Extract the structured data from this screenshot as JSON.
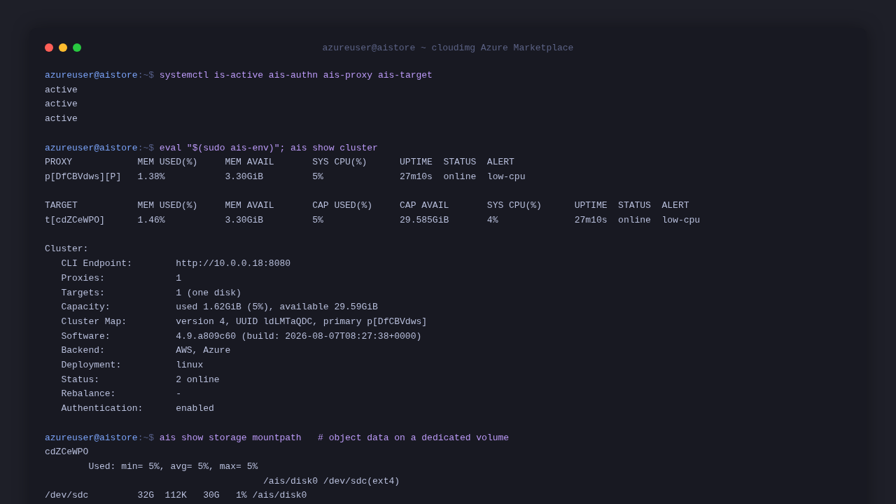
{
  "window": {
    "title": "azureuser@aistore ~ cloudimg Azure Marketplace",
    "buttons": [
      {
        "kind": "close"
      },
      {
        "kind": "minimize"
      },
      {
        "kind": "zoom"
      }
    ]
  },
  "blocks": [
    {
      "kind": "session",
      "prompt": {
        "user": "azureuser@aistore",
        "path": ":~$"
      },
      "command": "systemctl is-active ais-authn ais-proxy ais-target",
      "lines": [
        "active",
        "active",
        "active"
      ]
    },
    {
      "kind": "cluster",
      "prompt": {
        "user": "azureuser@aistore",
        "path": ":~$"
      },
      "command": "eval \"$(sudo ais-env)\"; ais show cluster",
      "tables": [
        {
          "columns": [
            "PROXY",
            "MEM USED(%)",
            "MEM AVAIL",
            "SYS CPU(%)",
            "UPTIME",
            "STATUS",
            "ALERT"
          ],
          "rows": [
            [
              "p[DfCBVdws][P]",
              "1.38%",
              "3.30GiB",
              "5%",
              "27m10s",
              "online",
              "low-cpu"
            ]
          ]
        },
        {
          "columns": [
            "TARGET",
            "MEM USED(%)",
            "MEM AVAIL",
            "CAP USED(%)",
            "CAP AVAIL",
            "SYS CPU(%)",
            "UPTIME",
            "STATUS",
            "ALERT"
          ],
          "rows": [
            [
              "t[cdZCeWPO]",
              "1.46%",
              "3.30GiB",
              "5%",
              "29.585GiB",
              "4%",
              "27m10s",
              "online",
              "low-cpu"
            ]
          ]
        }
      ],
      "summary": {
        "heading": "Cluster:",
        "fields": [
          {
            "label": "CLI Endpoint:",
            "value": "http://10.0.0.18:8080"
          },
          {
            "label": "Proxies:",
            "value": "1"
          },
          {
            "label": "Targets:",
            "value": "1 (one disk)"
          },
          {
            "label": "Capacity:",
            "value": "used 1.62GiB (5%), available 29.59GiB"
          },
          {
            "label": "Cluster Map:",
            "value": "version 4, UUID ldLMTaQDC, primary p[DfCBVdws]"
          },
          {
            "label": "Software:",
            "value": "4.9.a809c60 (build: 2026-08-07T08:27:38+0000)"
          },
          {
            "label": "Backend:",
            "value": "AWS, Azure"
          },
          {
            "label": "Deployment:",
            "value": "linux"
          },
          {
            "label": "Status:",
            "value": "2 online"
          },
          {
            "label": "Rebalance:",
            "value": "-"
          },
          {
            "label": "Authentication:",
            "value": "enabled"
          }
        ]
      }
    },
    {
      "kind": "mountpath",
      "prompt": {
        "user": "azureuser@aistore",
        "path": ":~$"
      },
      "command": "ais show storage mountpath",
      "comment": "# object data on a dedicated volume",
      "target": "cdZCeWPO",
      "usage": "Used: min= 5%, avg= 5%, max= 5%",
      "mount": "/ais/disk0 /dev/sdc(ext4)",
      "df": [
        "/dev/sdc",
        "32G",
        "112K",
        "30G",
        "1%",
        "/ais/disk0"
      ]
    }
  ]
}
